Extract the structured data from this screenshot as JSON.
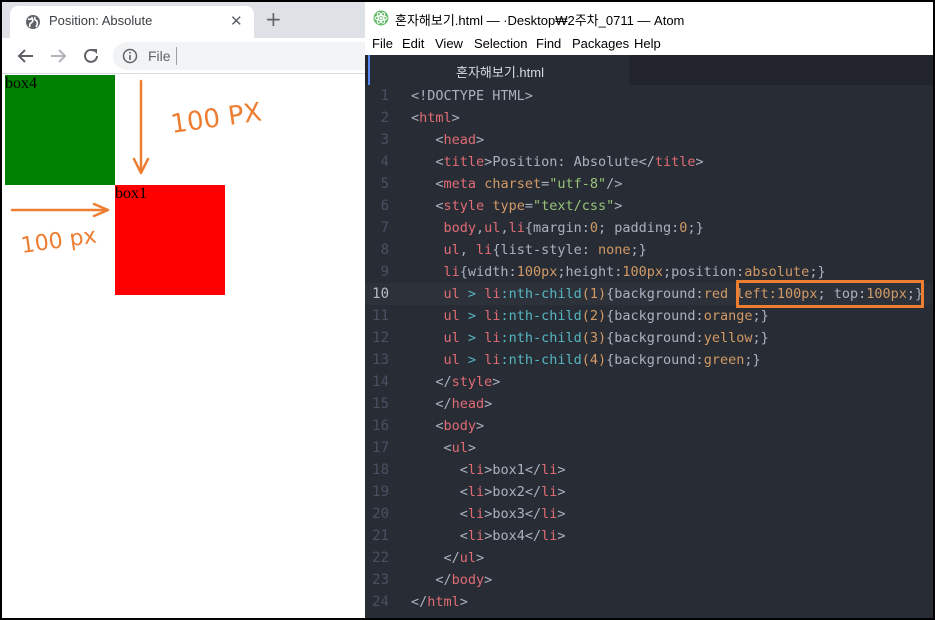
{
  "browser": {
    "tab_title": "Position: Absolute",
    "tab_close": "✕",
    "new_tab": "+",
    "address_scheme": "File",
    "page": {
      "box4_label": "box4",
      "box1_label": "box1",
      "box4_color": "#008000",
      "box1_color": "#ff0000"
    },
    "annotations": {
      "vertical_note": "100 PX",
      "horizontal_note": "100 px",
      "color": "#ed7d31"
    }
  },
  "atom": {
    "window_title": "혼자해보기.html — ·Desktop₩2주차_0711 — Atom",
    "menu": [
      "File",
      "Edit",
      "View",
      "Selection",
      "Find",
      "Packages",
      "Help"
    ],
    "tab_label": "혼자해보기.html",
    "active_line": 10,
    "highlight_color": "#ed7d31",
    "lines": [
      "<!DOCTYPE HTML>",
      "<html>",
      "   <head>",
      "   <title>Position: Absolute</title>",
      "   <meta charset=\"utf-8\"/>",
      "   <style type=\"text/css\">",
      "    body,ul,li{margin:0; padding:0;}",
      "    ul, li{list-style: none;}",
      "    li{width:100px;height:100px;position:absolute;}",
      "    ul > li:nth-child(1){background:red left:100px; top:100px;}",
      "    ul > li:nth-child(2){background:orange;}",
      "    ul > li:nth-child(3){background:yellow;}",
      "    ul > li:nth-child(4){background:green;}",
      "   </style>",
      "   </head>",
      "   <body>",
      "    <ul>",
      "      <li>box1</li>",
      "      <li>box2</li>",
      "      <li>box3</li>",
      "      <li>box4</li>",
      "    </ul>",
      "   </body>",
      "</html>"
    ]
  }
}
